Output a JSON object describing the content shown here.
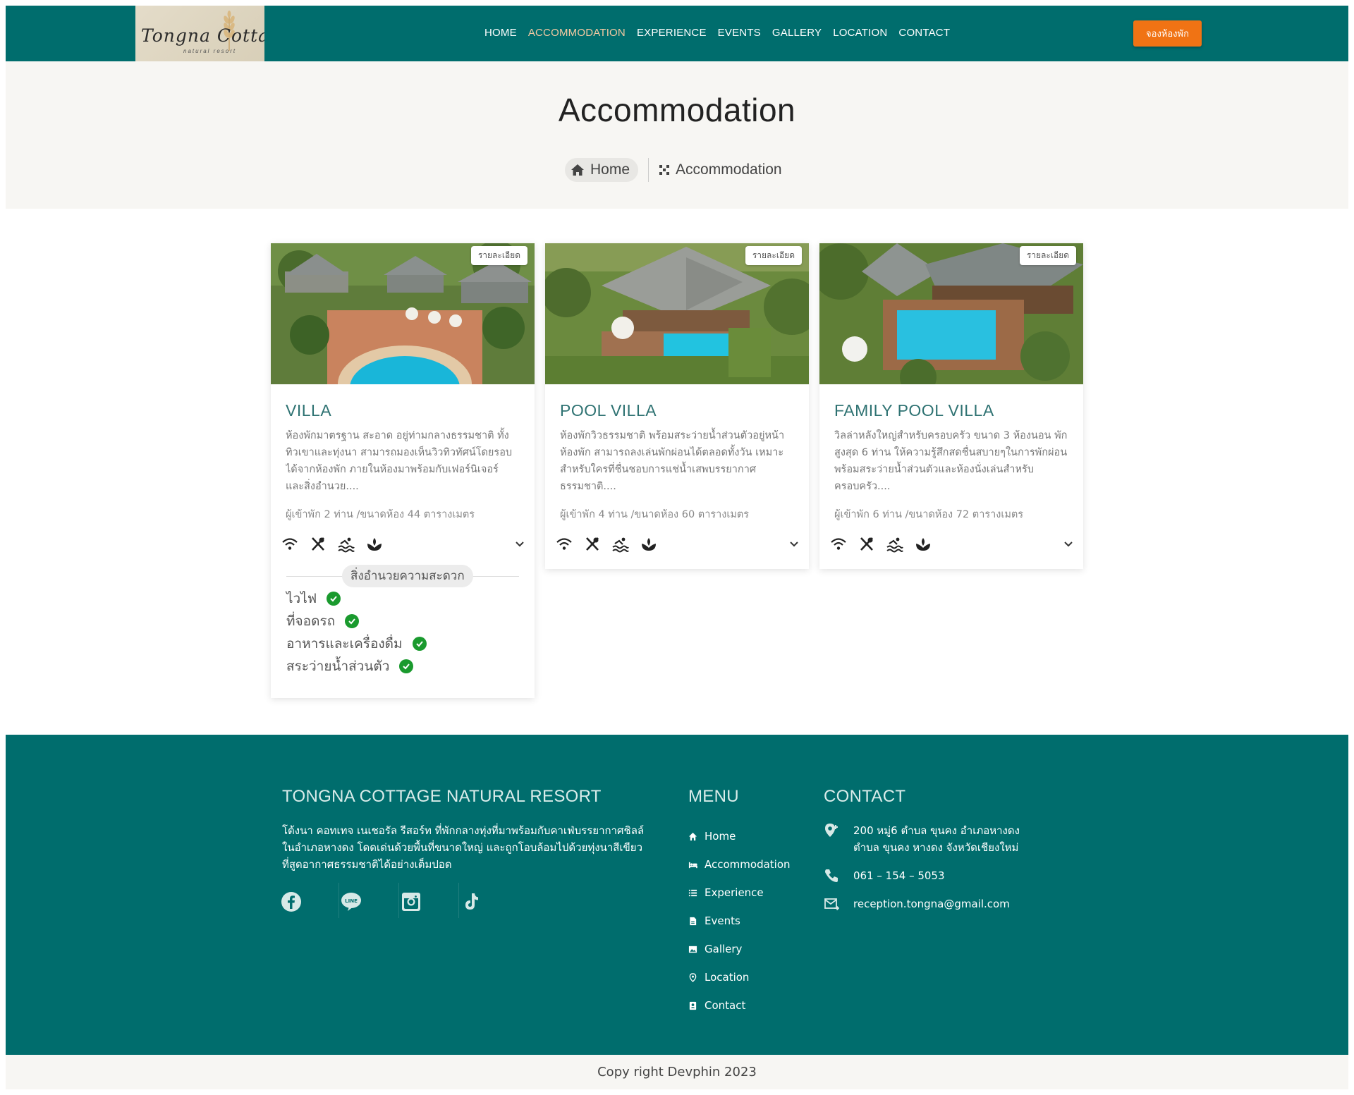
{
  "brand": {
    "logo_text": "Tongna Cottage",
    "logo_sub": "natural resort"
  },
  "nav": {
    "items": [
      {
        "label": "HOME"
      },
      {
        "label": "ACCOMMODATION"
      },
      {
        "label": "EXPERIENCE"
      },
      {
        "label": "EVENTS"
      },
      {
        "label": "GALLERY"
      },
      {
        "label": "LOCATION"
      },
      {
        "label": "CONTACT"
      }
    ],
    "active": "ACCOMMODATION",
    "book_label": "จองห้องพัก"
  },
  "hero": {
    "title": "Accommodation",
    "breadcrumb_home": "Home",
    "breadcrumb_current": "Accommodation"
  },
  "cards": [
    {
      "badge": "รายละเอียด",
      "title": "VILLA",
      "desc": "ห้องพักมาตรฐาน สะอาด อยู่ท่ามกลางธรรมชาติ ทั้งทิวเขาและทุ่งนา สามารถมองเห็นวิวทิวทัศน์โดยรอบได้จากห้องพัก ภายในห้องมาพร้อมกับเฟอร์นิเจอร์ และสิ่งอำนวย....",
      "meta": "ผู้เข้าพัก 2 ท่าน /ขนาดห้อง 44 ตารางเมตร",
      "icons": [
        "wifi-icon",
        "utensils-icon",
        "pool-icon",
        "spa-icon"
      ]
    },
    {
      "badge": "รายละเอียด",
      "title": "POOL VILLA",
      "desc": "ห้องพักวิวธรรมชาติ พร้อมสระว่ายน้ำส่วนตัวอยู่หน้าห้องพัก สามารถลงเล่นพักผ่อนได้ตลอดทั้งวัน เหมาะสำหรับใครที่ชื่นชอบการแช่น้ำเสพบรรยากาศธรรมชาติ....",
      "meta": "ผู้เข้าพัก 4 ท่าน /ขนาดห้อง 60 ตารางเมตร",
      "icons": [
        "wifi-icon",
        "utensils-icon",
        "pool-icon",
        "spa-icon"
      ]
    },
    {
      "badge": "รายละเอียด",
      "title": "FAMILY POOL VILLA",
      "desc": "วิลล่าหลังใหญ่สำหรับครอบครัว ขนาด 3 ห้องนอน พักสูงสุด 6 ท่าน ให้ความรู้สึกสดชื่นสบายๆในการพักผ่อน พร้อมสระว่ายน้ำส่วนตัวและห้องนั่งเล่นสำหรับครอบครัว....",
      "meta": "ผู้เข้าพัก 6 ท่าน /ขนาดห้อง 72 ตารางเมตร",
      "icons": [
        "wifi-icon",
        "utensils-icon",
        "pool-icon",
        "spa-icon"
      ]
    }
  ],
  "amenities": {
    "heading": "สิ่งอำนวยความสะดวก",
    "items": [
      "ไวไฟ",
      "ที่จอดรถ",
      "อาหารและเครื่องดื่ม",
      "สระว่ายน้ำส่วนตัว"
    ]
  },
  "footer": {
    "about_title": "TONGNA COTTAGE NATURAL RESORT",
    "about_text": "โต้งนา คอทเทจ เนเชอรัล รีสอร์ท ที่พักกลางทุ่งที่มาพร้อมกับคาเฟ่บรรยากาศชิลล์ในอำเภอหางดง โดดเด่นด้วยพื้นที่ขนาดใหญ่ และถูกโอบล้อมไปด้วยทุ่งนาสีเขียว ที่สูดอากาศธรรมชาติได้อย่างเต็มปอด",
    "social": [
      "facebook-icon",
      "line-icon",
      "instagram-icon",
      "tiktok-icon"
    ],
    "menu_title": "MENU",
    "menu": [
      "Home",
      "Accommodation",
      "Experience",
      "Events",
      "Gallery",
      "Location",
      "Contact"
    ],
    "contact_title": "CONTACT",
    "address": "200 หมู่6 ตำบล ขุนคง อำเภอหางดง ตำบล ขุนคง หางดง จังหวัดเชียงใหม่",
    "phone": "061 – 154 – 5053",
    "email": "reception.tongna@gmail.com"
  },
  "copyright": "Copy right Devphin 2023",
  "colors": {
    "primary": "#006d6d",
    "accent": "#f07314",
    "check": "#1a9a2e"
  }
}
